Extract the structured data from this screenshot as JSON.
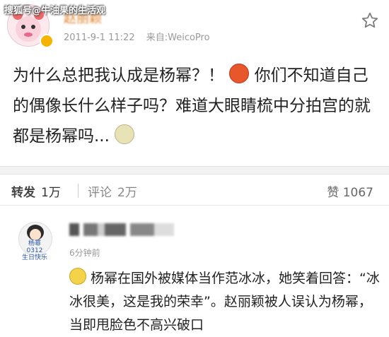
{
  "watermark": "搜狐号@牛油果的生活观",
  "post": {
    "username": "赵丽颖",
    "timestamp": "2011-9-1 11:22",
    "source": "来自:WeicoPro",
    "text_part1": "为什么总把我认成是杨幂？！",
    "text_part2": "你们不知道自己的偶像长什么样子吗？难道大眼睛梳中分拍宫的就都是杨幂吗...",
    "emoji_1": "angry-face-icon",
    "emoji_2": "sweat-face-icon"
  },
  "actions": {
    "repost_label": "转发",
    "repost_count": "1万",
    "comment_label": "评论",
    "comment_count": "2万",
    "like_label": "赞",
    "like_count": "1067"
  },
  "comment": {
    "time": "6分钟前",
    "avatar_caption_line1": "杨幂",
    "avatar_caption_line2": "0312",
    "avatar_caption_line3": "生日快乐",
    "text": "杨幂在国外被媒体当作范冰冰，她笑着回答：“冰冰很美，这是我的荣幸”。赵丽颖被人误认为杨幂，当即甩脸色不高兴破口",
    "emoji": "smile-face-icon"
  },
  "colors": {
    "username": "#e0842d",
    "meta": "#9a9a9a",
    "divider": "#f2f2f2"
  }
}
